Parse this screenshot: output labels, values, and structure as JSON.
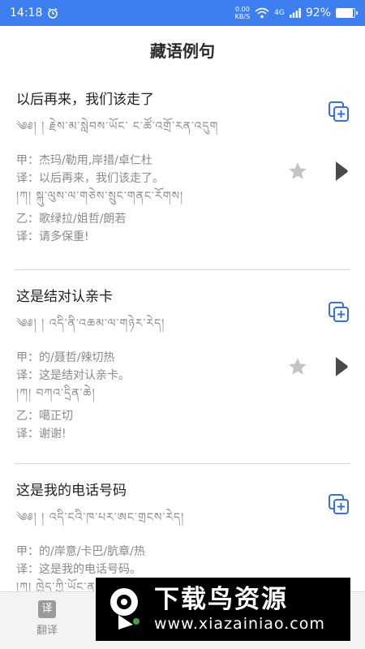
{
  "status": {
    "time": "14:18",
    "speed_value": "0.00",
    "speed_unit": "KB/S",
    "network": "4G",
    "battery": "92%",
    "battery_level": 0.92
  },
  "header": {
    "title": "藏语例句"
  },
  "cards": [
    {
      "title": "以后再来，我们该走了",
      "tibetan": "༄༅། །  རྗེས་མ་སླེབས་ཡོང་    ང་ཚོ་འགྲོ་རན་འདུག",
      "speaker_a": "甲：杰玛/勒用,岸措/卓仁杜",
      "translation_a": "译：以后再来，我们该走了。",
      "tibetan_line": "།ཀ།   སྐུ་ལུས་ལ་གཅེས་སྲུང་གནང་རོགས།",
      "speaker_b": "乙：歌绿拉/姐哲/朗若",
      "translation_b": "译：请多保重!"
    },
    {
      "title": "这是结对认亲卡",
      "tibetan": "༄༅། །  འདི་ནི་འཆམ་ལ་གཉེར་རེད།",
      "speaker_a": "甲：的/聂哲/辣切热",
      "translation_a": "译：这是结对认亲卡。",
      "tibetan_line": "།ཀ།   བཀའ་དྲིན་ཆེ།",
      "speaker_b": "乙：噶正切",
      "translation_b": "译：谢谢!"
    },
    {
      "title": "这是我的电话号码",
      "tibetan": "༄༅། །  འདི་ངའི་ཁ་པར་ཨང་གྲངས་རེད།",
      "speaker_a": "甲：的/岸意/卡巴/肮章/热",
      "translation_a": "译：这是我的电话号码。",
      "tibetan_line": "།ཀ།   ཁྱེད་ཀྱི་ཡོང་ན་ཁ་པར་གཏོང་རོགས།"
    }
  ],
  "nav": {
    "translate_label": "翻译",
    "translate_icon_text": "译"
  },
  "watermark": {
    "title": "下载鸟资源",
    "url": "www.xiazainiao.com"
  }
}
